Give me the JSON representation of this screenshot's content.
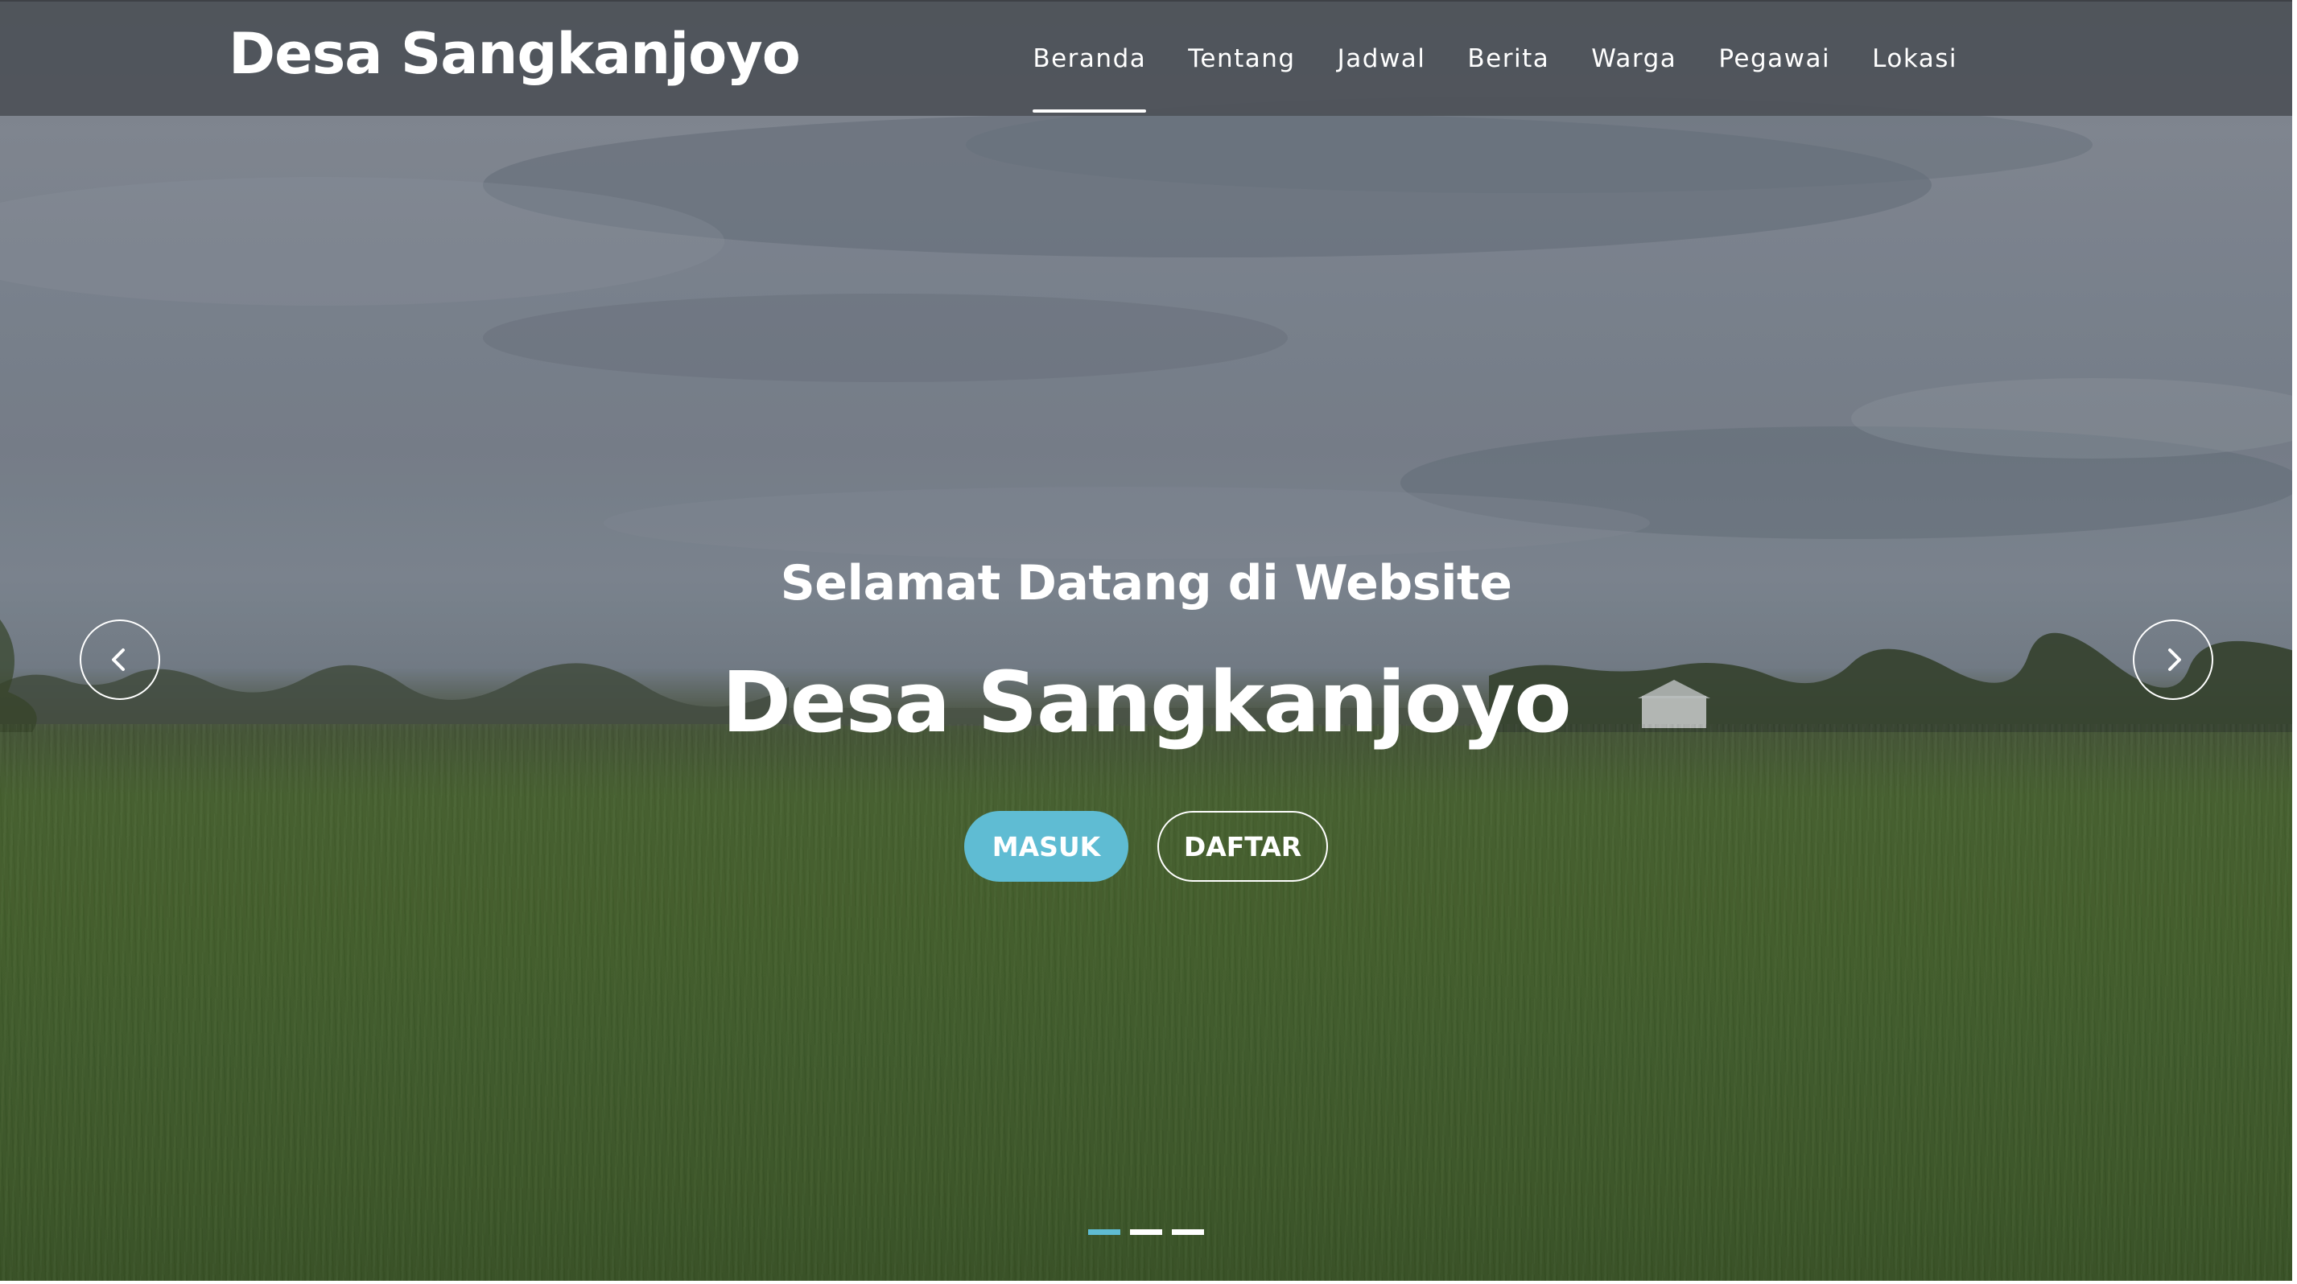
{
  "brand": {
    "name": "Desa Sangkanjoyo"
  },
  "nav": {
    "items": [
      {
        "label": "Beranda",
        "active": true
      },
      {
        "label": "Tentang",
        "active": false
      },
      {
        "label": "Jadwal",
        "active": false
      },
      {
        "label": "Berita",
        "active": false
      },
      {
        "label": "Warga",
        "active": false
      },
      {
        "label": "Pegawai",
        "active": false
      },
      {
        "label": "Lokasi",
        "active": false
      }
    ]
  },
  "hero": {
    "subtitle": "Selamat Datang di Website",
    "title": "Desa Sangkanjoyo",
    "buttons": {
      "login_label": "MASUK",
      "register_label": "DAFTAR"
    },
    "prev_icon": "chevron-left-icon",
    "next_icon": "chevron-right-icon",
    "slides_count": 3,
    "active_slide": 1
  },
  "colors": {
    "navbar": "#4e5258",
    "accent": "#5fbcd3",
    "text": "#ffffff"
  }
}
